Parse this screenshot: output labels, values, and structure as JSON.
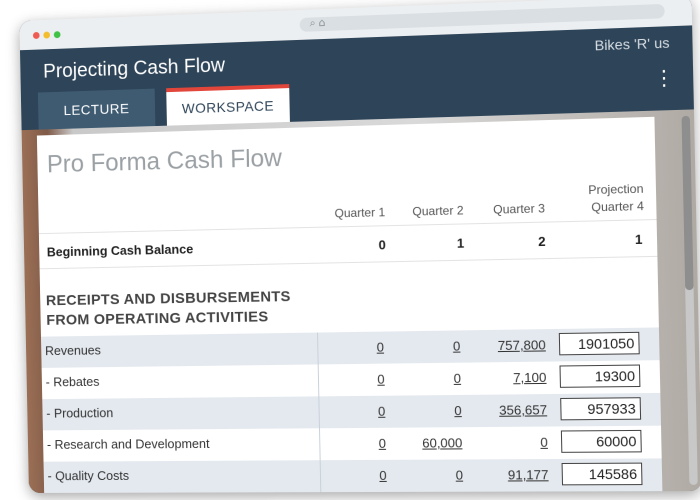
{
  "app": {
    "title": "Projecting Cash Flow",
    "brand": "Bikes 'R' us",
    "menu_icon": "kebab-menu-icon"
  },
  "tabs": [
    {
      "label": "LECTURE",
      "active": false
    },
    {
      "label": "WORKSPACE",
      "active": true
    }
  ],
  "colors": {
    "header": "#2e4458",
    "tab_accent": "#e2463b",
    "row_shade": "#e4e9ef"
  },
  "panel": {
    "title": "Pro Forma Cash Flow",
    "columns": [
      "Quarter 1",
      "Quarter 2",
      "Quarter 3",
      "Projection Quarter 4"
    ],
    "beginning_cash": {
      "label": "Beginning Cash Balance",
      "values": [
        "0",
        "1",
        "2",
        "1"
      ]
    },
    "section_title_line1": "RECEIPTS AND DISBURSEMENTS",
    "section_title_line2": "FROM OPERATING ACTIVITIES",
    "rows": [
      {
        "label": "Revenues",
        "q1": "0",
        "q2": "0",
        "q3": "757,800",
        "q4": "1901050"
      },
      {
        "label": "- Rebates",
        "q1": "0",
        "q2": "0",
        "q3": "7,100",
        "q4": "19300"
      },
      {
        "label": "- Production",
        "q1": "0",
        "q2": "0",
        "q3": "356,657",
        "q4": "957933"
      },
      {
        "label": "- Research and Development",
        "q1": "0",
        "q2": "60,000",
        "q3": "0",
        "q4": "60000"
      },
      {
        "label": "- Quality Costs",
        "q1": "0",
        "q2": "0",
        "q3": "91,177",
        "q4": "145586"
      }
    ]
  }
}
